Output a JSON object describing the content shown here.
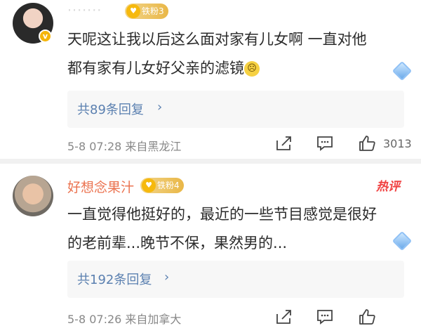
{
  "comments": [
    {
      "username": "·······",
      "fan_badge": "铁粉3",
      "content_line1": "天呢这让我以后这么面对家有儿女啊 一直对他",
      "content_line2": "都有家有儿女好父亲的滤镜",
      "emoji": "☹",
      "replies": "共89条回复",
      "meta": "5-8 07:28  来自黑龙江",
      "like_count": "3013"
    },
    {
      "username": "好想念果汁",
      "fan_badge": "铁粉4",
      "hot_tag": "热评",
      "content_line1": "一直觉得他挺好的，最近的一些节目感觉是很好",
      "content_line2": "的老前辈...晚节不保，果然男的...",
      "replies": "共192条回复",
      "meta": "5-8 07:26  来自加拿大"
    }
  ],
  "icons": {
    "share": "share-icon",
    "comment": "comment-icon",
    "like": "like-icon",
    "chevron": "›"
  },
  "colors": {
    "link": "#5b80b0",
    "username_highlight": "#eb7350",
    "hot": "#f04040",
    "badge": "#e9b747"
  }
}
